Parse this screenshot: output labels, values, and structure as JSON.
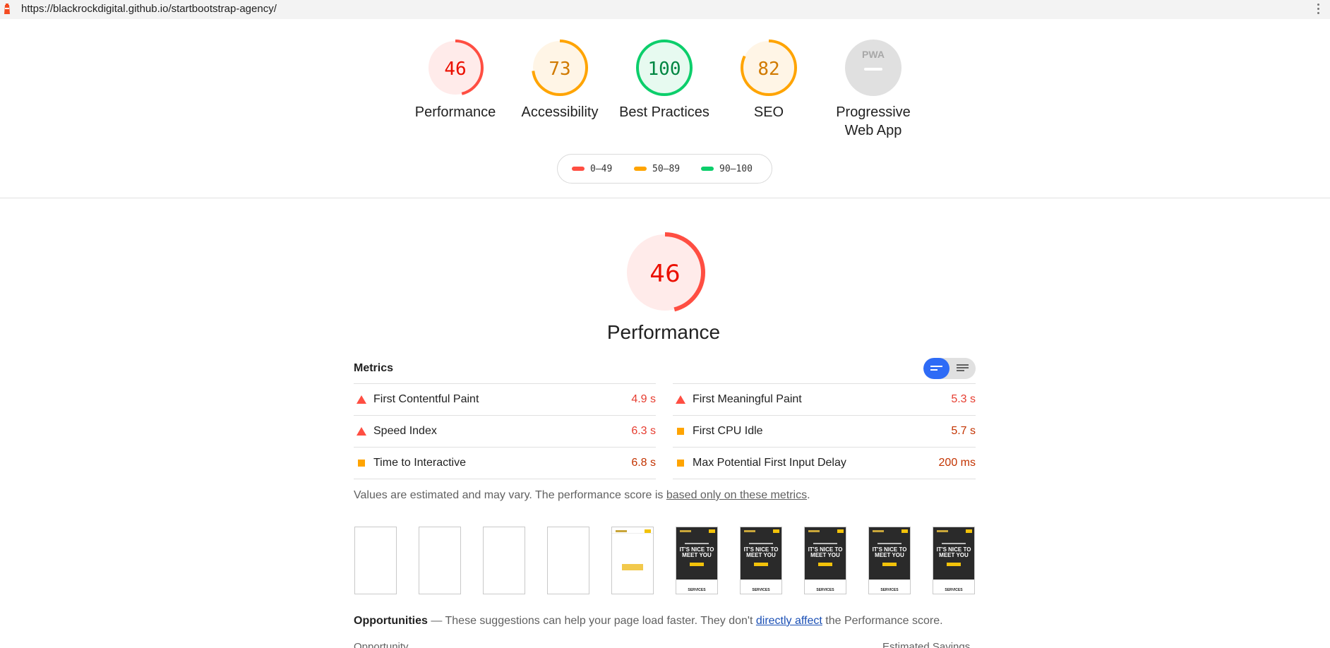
{
  "browser": {
    "url": "https://blackrockdigital.github.io/startbootstrap-agency/"
  },
  "gauges": [
    {
      "label": "Performance",
      "value": "46",
      "score": 46,
      "rating": "fail"
    },
    {
      "label": "Accessibility",
      "value": "73",
      "score": 73,
      "rating": "average"
    },
    {
      "label": "Best Practices",
      "value": "100",
      "score": 100,
      "rating": "pass"
    },
    {
      "label": "SEO",
      "value": "82",
      "score": 82,
      "rating": "average"
    },
    {
      "label_line1": "Progressive",
      "label_line2": "Web App",
      "badge": "PWA"
    }
  ],
  "legend": {
    "fail": "0–49",
    "average": "50–89",
    "pass": "90–100"
  },
  "colors": {
    "fail": "#ff4e42",
    "average": "#ffa400",
    "pass": "#0cce6b",
    "fail_bg": "#ffebea",
    "average_bg": "#fff5e6",
    "pass_bg": "#e7faf0",
    "pwa_bg": "#e0e0e0",
    "toggle_accent": "#2e6bf6"
  },
  "performance": {
    "score": "46",
    "score_value": 46,
    "title": "Performance"
  },
  "metrics": {
    "title": "Metrics",
    "left": [
      {
        "name": "First Contentful Paint",
        "value": "4.9 s",
        "rating": "fail"
      },
      {
        "name": "Speed Index",
        "value": "6.3 s",
        "rating": "fail"
      },
      {
        "name": "Time to Interactive",
        "value": "6.8 s",
        "rating": "average"
      }
    ],
    "right": [
      {
        "name": "First Meaningful Paint",
        "value": "5.3 s",
        "rating": "fail"
      },
      {
        "name": "First CPU Idle",
        "value": "5.7 s",
        "rating": "average"
      },
      {
        "name": "Max Potential First Input Delay",
        "value": "200 ms",
        "rating": "average"
      }
    ],
    "note_prefix": "Values are estimated and may vary. The performance score is ",
    "note_link": "based only on these metrics",
    "note_suffix": "."
  },
  "filmstrip": {
    "hero_text": "IT'S NICE TO MEET YOU",
    "section_text": "SERVICES"
  },
  "opportunities": {
    "title": "Opportunities",
    "desc_prefix": " — These suggestions can help your page load faster. They don't ",
    "desc_link": "directly affect",
    "desc_suffix": " the Performance score.",
    "col_left": "Opportunity",
    "col_right": "Estimated Savings"
  }
}
